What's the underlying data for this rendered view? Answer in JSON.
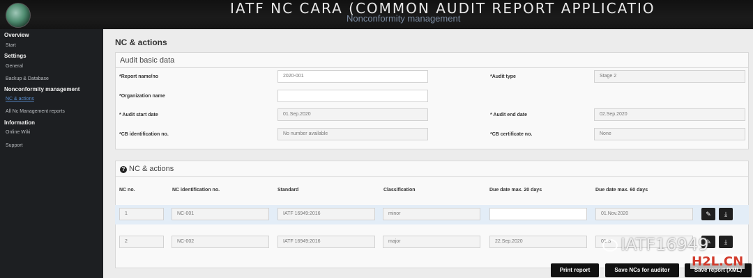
{
  "header": {
    "title": "IATF NC CARA (COMMON AUDIT REPORT APPLICATIO",
    "subtitle": "Nonconformity management"
  },
  "sidebar": {
    "groups": [
      {
        "label": "Overview",
        "items": [
          "Start"
        ]
      },
      {
        "label": "Settings",
        "items": [
          "General",
          "Backup & Database"
        ]
      },
      {
        "label": "Nonconformity management",
        "items": [
          "NC & actions",
          "All Nc Management reports"
        ]
      },
      {
        "label": "Information",
        "items": [
          "Online Wiki",
          "Support"
        ]
      }
    ],
    "active_item": "NC & actions"
  },
  "main": {
    "page_title": "NC & actions",
    "audit_panel": {
      "title": "Audit basic data",
      "report_label": "*Report name/no",
      "report_value": "2020-001",
      "audit_type_label": "*Audit type",
      "audit_type_value": "Stage 2",
      "org_label": "*Organization name",
      "org_value": "",
      "start_label": "* Audit start date",
      "start_value": "01.Sep.2020",
      "end_label": "* Audit end date",
      "end_value": "02.Sep.2020",
      "cb_id_label": "*CB identification no.",
      "cb_id_value": "No number available",
      "cb_cert_label": "*CB certificate no.",
      "cb_cert_value": "None"
    },
    "nc_panel": {
      "title": "NC & actions",
      "columns": [
        "NC no.",
        "NC identification no.",
        "Standard",
        "Classification",
        "Due date max. 20 days",
        "Due date max. 60 days"
      ],
      "rows": [
        {
          "no": "1",
          "id": "NC-001",
          "standard": "IATF 16949:2016",
          "classification": "minor",
          "due20": "",
          "due60": "01.Nov.2020"
        },
        {
          "no": "2",
          "id": "NC-002",
          "standard": "IATF 16949:2016",
          "classification": "major",
          "due20": "22.Sep.2020",
          "due60": "01.S"
        }
      ]
    },
    "buttons": {
      "print": "Print report",
      "save_ncs": "Save NCs for auditor",
      "save_xml": "Save report (XML)"
    }
  },
  "watermark": {
    "text": "IATF16949",
    "badge": "H2L.CN"
  },
  "icons": {
    "edit": "pencil-icon",
    "download": "download-icon",
    "help": "question-circle-icon"
  }
}
